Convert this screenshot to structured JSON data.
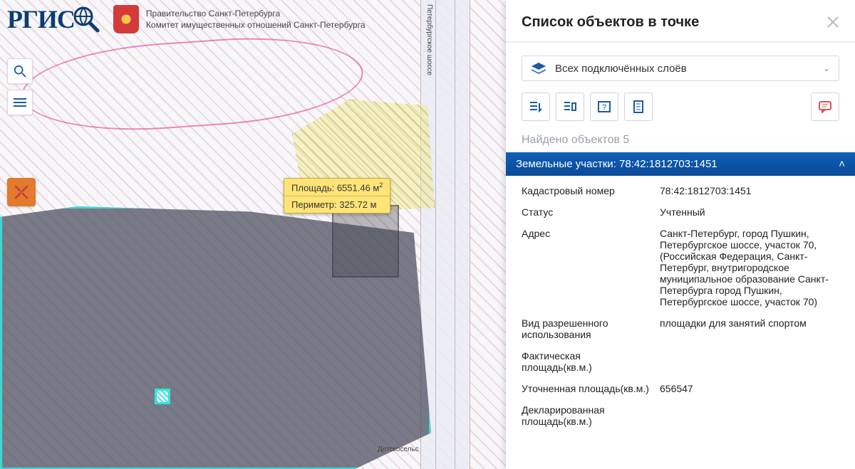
{
  "app": {
    "logo_text": "РГИС"
  },
  "gov": {
    "line1": "Правительство Санкт-Петербурга",
    "line2": "Комитет имущественных отношений Санкт-Петербурга"
  },
  "roads": {
    "vertical": "Петербургское шоссе",
    "horizontal": "Детскосельс"
  },
  "measure": {
    "area_label": "Площадь:",
    "area_value": "6551.46 м",
    "area_unit_sup": "2",
    "perimeter_label": "Периметр:",
    "perimeter_value": "325.72 м"
  },
  "panel": {
    "title": "Список объектов в точке",
    "layer_select": "Всех подключённых слоёв",
    "found_label": "Найдено объектов",
    "found_count": "5",
    "section_title": "Земельные участки: 78:42:1812703:1451",
    "rows": [
      {
        "k": "Кадастровый номер",
        "v": "78:42:1812703:1451"
      },
      {
        "k": "Статус",
        "v": "Учтенный"
      },
      {
        "k": "Адрес",
        "v": "Санкт-Петербург, город Пушкин, Петербургское шоссе, участок 70, (Российская Федерация, Санкт-Петербург, внутригородское муниципальное образование Санкт-Петербурга город Пушкин, Петербургское шоссе, участок 70)"
      },
      {
        "k": "Вид разрешенного использования",
        "v": "площадки для занятий спортом"
      },
      {
        "k": "Фактическая площадь(кв.м.)",
        "v": ""
      },
      {
        "k": "Уточненная площадь(кв.м.)",
        "v": "656547"
      },
      {
        "k": "Декларированная площадь(кв.м.)",
        "v": ""
      }
    ]
  }
}
